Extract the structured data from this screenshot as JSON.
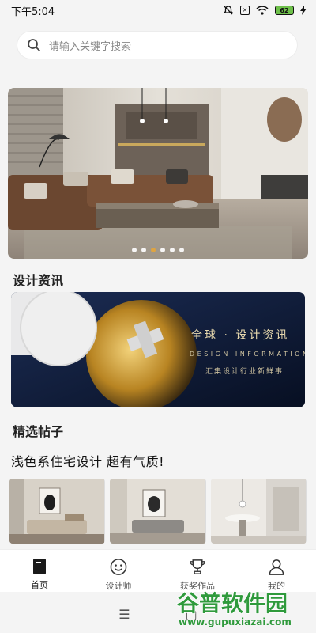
{
  "status_bar": {
    "time": "下午5:04",
    "battery": "62"
  },
  "search": {
    "placeholder": "请输入关键字搜索"
  },
  "banner": {
    "dots": 6,
    "active_dot": 2
  },
  "sections": {
    "news_title": "设计资讯",
    "posts_title": "精选帖子"
  },
  "info_card": {
    "heading": "全球 · 设计资讯",
    "subheading_en": "DESIGN INFORMATION",
    "subheading_cn": "汇集设计行业新鲜事"
  },
  "post": {
    "title": "浅色系住宅设计 超有气质!"
  },
  "tabs": [
    {
      "label": "首页",
      "icon": "home-icon"
    },
    {
      "label": "设计师",
      "icon": "smiley-icon"
    },
    {
      "label": "获奖作品",
      "icon": "trophy-icon"
    },
    {
      "label": "我的",
      "icon": "person-icon"
    }
  ],
  "system_nav": {
    "menu": "☰",
    "home": "▢"
  },
  "watermark": {
    "cn": "谷普软件园",
    "url": "www.gupuxiazai.com"
  },
  "colors": {
    "accent_dot": "#e4a53a",
    "info_bg": "#0c1a36",
    "info_text": "#e8d9ae",
    "watermark_green": "#2f9a3c"
  }
}
